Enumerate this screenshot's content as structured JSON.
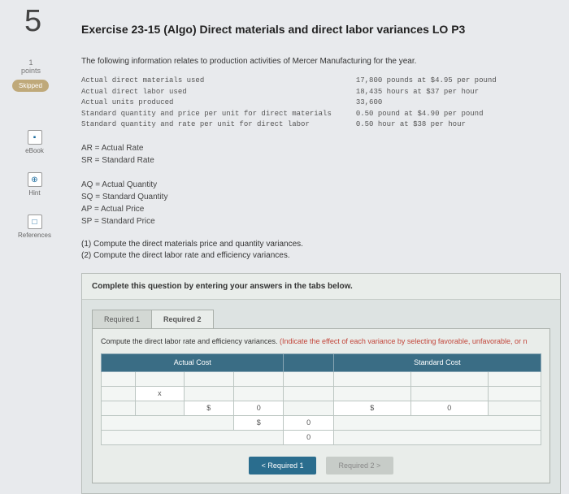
{
  "question_number": "5",
  "title": "Exercise 23-15 (Algo) Direct materials and direct labor variances LO P3",
  "points": {
    "num": "1",
    "label": "points"
  },
  "skipped": "Skipped",
  "sidebar": {
    "ebook": {
      "icon": "▪",
      "label": "eBook"
    },
    "hint": {
      "icon": "⊕",
      "label": "Hint"
    },
    "refs": {
      "icon": "□",
      "label": "References"
    }
  },
  "intro": "The following information relates to production activities of Mercer Manufacturing for the year.",
  "data_left": "Actual direct materials used\nActual direct labor used\nActual units produced\nStandard quantity and price per unit for direct materials\nStandard quantity and rate per unit for direct labor",
  "data_right": "17,800 pounds at $4.95 per pound\n18,435 hours at $37 per hour\n33,600\n0.50 pound at $4.90 per pound\n0.50 hour at $38 per hour",
  "defs": "AR = Actual Rate\nSR = Standard Rate\n\nAQ = Actual Quantity\nSQ = Standard Quantity\nAP = Actual Price\nSP = Standard Price",
  "tasks": {
    "t1": "(1) Compute the direct materials price and quantity variances.",
    "t2": "(2) Compute the direct labor rate and efficiency variances."
  },
  "answer": {
    "complete": "Complete this question by entering your answers in the tabs below.",
    "tab1": "Required 1",
    "tab2": "Required 2",
    "tab_instr": "Compute the direct labor rate and efficiency variances. ",
    "tab_hint": "(Indicate the effect of each variance by selecting favorable, unfavorable, or n",
    "col_actual": "Actual Cost",
    "col_standard": "Standard Cost",
    "cell_x": "x",
    "cell_sym": "$",
    "cell_zero": "0",
    "nav_prev": "<  Required 1",
    "nav_next": "Required 2  >"
  }
}
